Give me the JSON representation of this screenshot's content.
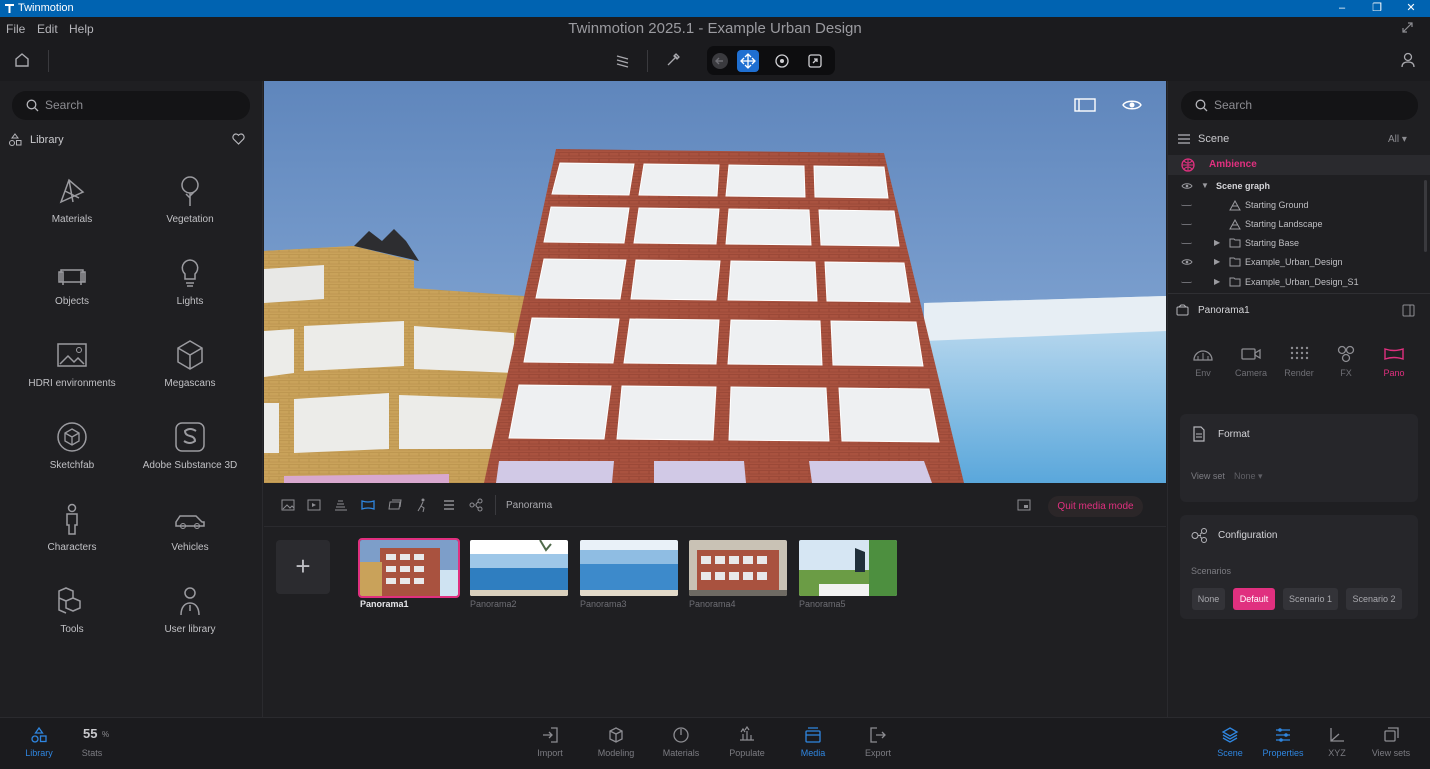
{
  "window": {
    "app_name": "Twinmotion",
    "title": "Twinmotion 2025.1 - Example Urban Design"
  },
  "menu": [
    "File",
    "Edit",
    "Help"
  ],
  "colors": {
    "accent_pink": "#e0307f",
    "accent_blue": "#2f86e0",
    "titlebar": "#0063b1"
  },
  "left": {
    "search_placeholder": "Search",
    "library_label": "Library",
    "items": [
      {
        "label": "Materials",
        "icon": "materials-icon"
      },
      {
        "label": "Vegetation",
        "icon": "tree-icon"
      },
      {
        "label": "Objects",
        "icon": "sofa-icon"
      },
      {
        "label": "Lights",
        "icon": "bulb-icon"
      },
      {
        "label": "HDRI environments",
        "icon": "hdri-icon"
      },
      {
        "label": "Megascans",
        "icon": "megascans-icon"
      },
      {
        "label": "Sketchfab",
        "icon": "sketchfab-icon"
      },
      {
        "label": "Adobe Substance 3D",
        "icon": "substance-icon"
      },
      {
        "label": "Characters",
        "icon": "person-icon"
      },
      {
        "label": "Vehicles",
        "icon": "car-icon"
      },
      {
        "label": "Tools",
        "icon": "cubes-icon"
      },
      {
        "label": "User library",
        "icon": "user-library-icon"
      }
    ]
  },
  "media": {
    "mode_label": "Panorama",
    "quit_label": "Quit media mode",
    "add_label": "+",
    "panoramas": [
      "Panorama1",
      "Panorama2",
      "Panorama3",
      "Panorama4",
      "Panorama5"
    ],
    "selected": "Panorama1"
  },
  "right": {
    "search_placeholder": "Search",
    "scene_label": "Scene",
    "filter_label": "All",
    "ambience_label": "Ambience",
    "tree": [
      {
        "label": "Scene graph"
      },
      {
        "label": "Starting Ground"
      },
      {
        "label": "Starting Landscape"
      },
      {
        "label": "Starting Base"
      },
      {
        "label": "Example_Urban_Design"
      },
      {
        "label": "Example_Urban_Design_S1"
      }
    ],
    "selection_title": "Panorama1",
    "tabs": [
      {
        "label": "Env",
        "icon": "env-icon"
      },
      {
        "label": "Camera",
        "icon": "camera-icon"
      },
      {
        "label": "Render",
        "icon": "render-icon"
      },
      {
        "label": "FX",
        "icon": "fx-icon"
      },
      {
        "label": "Pano",
        "icon": "pano-icon"
      }
    ],
    "active_tab": "Pano",
    "format_title": "Format",
    "view_set_label": "View set",
    "view_set_value": "None",
    "configuration_title": "Configuration",
    "scenarios_label": "Scenarios",
    "scenarios": [
      "None",
      "Default",
      "Scenario 1",
      "Scenario 2"
    ],
    "active_scenario": "Default"
  },
  "bottom": {
    "library_label": "Library",
    "stats_value": "55",
    "stats_unit": "%",
    "stats_label": "Stats",
    "center": [
      "Import",
      "Modeling",
      "Materials",
      "Populate",
      "Media",
      "Export"
    ],
    "active_center": "Media",
    "right": [
      "Scene",
      "Properties",
      "XYZ",
      "View sets"
    ]
  }
}
